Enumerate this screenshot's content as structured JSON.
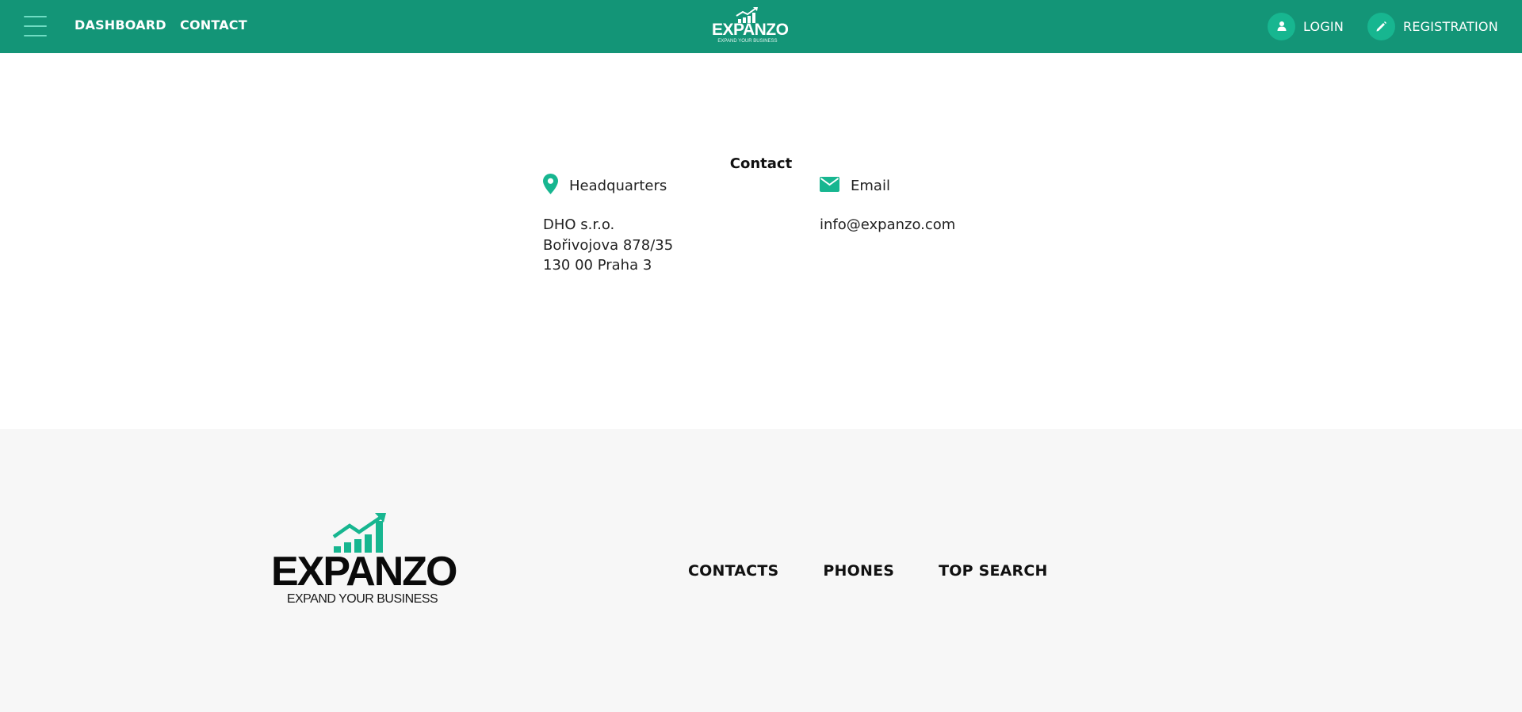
{
  "header": {
    "nav": {
      "dashboard": "DASHBOARD",
      "contact": "CONTACT"
    },
    "logo": {
      "name": "EXPANZO",
      "tagline": "EXPAND YOUR BUSINESS"
    },
    "auth": {
      "login": "LOGIN",
      "registration": "REGISTRATION"
    }
  },
  "contact": {
    "title": "Contact",
    "headquarters": {
      "label": "Headquarters",
      "lines": [
        "DHO s.r.o.",
        "Bořivojova 878/35",
        "130 00 Praha 3"
      ]
    },
    "email": {
      "label": "Email",
      "value": "info@expanzo.com"
    }
  },
  "footer": {
    "logo": {
      "name": "EXPANZO",
      "tagline": "EXPAND YOUR BUSINESS"
    },
    "links": [
      "CONTACTS",
      "PHONES",
      "TOP SEARCH"
    ]
  },
  "icons": {
    "menu": "hamburger-menu-icon",
    "login": "user-icon",
    "registration": "pencil-icon",
    "headquarters": "map-pin-icon",
    "email": "envelope-icon"
  },
  "colors": {
    "header_bg": "#139577",
    "accent": "#17b690",
    "footer_bg": "#f7f7f7"
  }
}
